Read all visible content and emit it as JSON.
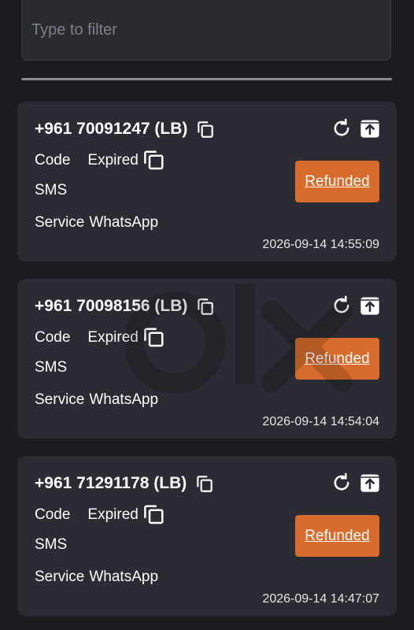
{
  "filter": {
    "placeholder": "Type to filter"
  },
  "orders": [
    {
      "phone": "+961 70091247 (LB)",
      "code_label": "Code",
      "code_value": "Expired",
      "type": "SMS",
      "service_label": "Service",
      "service_value": "WhatsApp",
      "status": "Refunded",
      "timestamp": "2026-09-14 14:55:09"
    },
    {
      "phone": "+961 70098156 (LB)",
      "code_label": "Code",
      "code_value": "Expired",
      "type": "SMS",
      "service_label": "Service",
      "service_value": "WhatsApp",
      "status": "Refunded",
      "timestamp": "2026-09-14 14:54:04"
    },
    {
      "phone": "+961 71291178 (LB)",
      "code_label": "Code",
      "code_value": "Expired",
      "type": "SMS",
      "service_label": "Service",
      "service_value": "WhatsApp",
      "status": "Refunded",
      "timestamp": "2026-09-14 14:47:07"
    }
  ],
  "watermark": {
    "text": "olx",
    "icon": "olx-logo-watermark"
  },
  "colors": {
    "background": "#1b1c20",
    "card": "#2b2c33",
    "accent": "#d86c2c"
  }
}
